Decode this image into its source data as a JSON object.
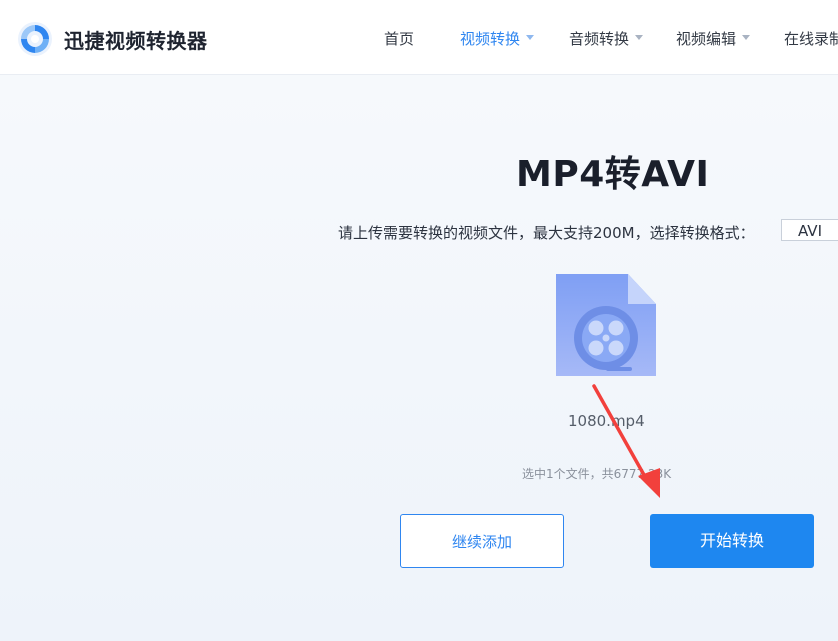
{
  "header": {
    "brand": "迅捷视频转换器",
    "nav": [
      {
        "label": "首页",
        "active": false,
        "has_dropdown": false
      },
      {
        "label": "视频转换",
        "active": true,
        "has_dropdown": true
      },
      {
        "label": "音频转换",
        "active": false,
        "has_dropdown": true
      },
      {
        "label": "视频编辑",
        "active": false,
        "has_dropdown": true
      },
      {
        "label": "在线录制",
        "active": false,
        "has_dropdown": false
      }
    ]
  },
  "main": {
    "title": "MP4转AVI",
    "instruction": "请上传需要转换的视频文件，最大支持200M，选择转换格式：",
    "format_value": "AVI",
    "file": {
      "name": "1080.mp4",
      "icon": "video-file-icon"
    },
    "summary": "选中1个文件，共6777.23K",
    "buttons": {
      "add": "继续添加",
      "start": "开始转换"
    },
    "annotation": {
      "icon": "red-arrow",
      "color": "#f2403c"
    }
  },
  "colors": {
    "accent": "#2f86f0",
    "primary_button": "#1e87f0",
    "file_icon": "#8aa9f5"
  }
}
